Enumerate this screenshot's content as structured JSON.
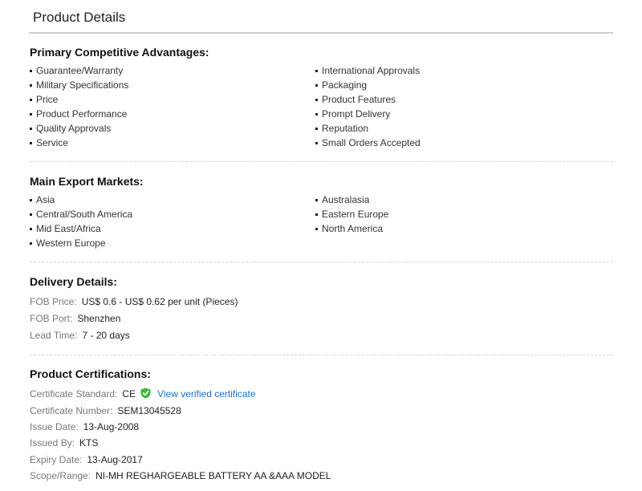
{
  "page": {
    "title": "Product Details"
  },
  "advantages": {
    "heading": "Primary Competitive Advantages:",
    "left": [
      "Guarantee/Warranty",
      "Military Specifications",
      "Price",
      "Product Performance",
      "Quality Approvals",
      "Service"
    ],
    "right": [
      "International Approvals",
      "Packaging",
      "Product Features",
      "Prompt Delivery",
      "Reputation",
      "Small Orders Accepted"
    ]
  },
  "markets": {
    "heading": "Main Export Markets:",
    "left": [
      "Asia",
      "Central/South America",
      "Mid East/Africa",
      "Western Europe"
    ],
    "right": [
      "Australasia",
      "Eastern Europe",
      "North America"
    ]
  },
  "delivery": {
    "heading": "Delivery Details:",
    "fob_price_label": "FOB Price:",
    "fob_price_value": "US$ 0.6 - US$ 0.62 per unit (Pieces)",
    "fob_port_label": "FOB Port:",
    "fob_port_value": "Shenzhen",
    "lead_time_label": "Lead Time:",
    "lead_time_value": "7 - 20 days"
  },
  "certifications": {
    "heading": "Product Certifications:",
    "standard_label": "Certificate Standard:",
    "standard_value": "CE",
    "verified_icon": "shield-check-icon",
    "verified_color": "#3db83d",
    "link_text": "View verified certificate",
    "number_label": "Certificate Number:",
    "number_value": "SEM13045528",
    "issue_label": "Issue Date:",
    "issue_value": "13-Aug-2008",
    "issued_by_label": "Issued By:",
    "issued_by_value": "KTS",
    "expiry_label": "Expiry Date:",
    "expiry_value": "13-Aug-2017",
    "scope_label": "Scope/Range:",
    "scope_value": "NI-MH REGHARGEABLE BATTERY AA &AAA MODEL"
  },
  "colors": {
    "link": "#1f6fc9",
    "label": "#777777",
    "rule": "#cfcfcf"
  }
}
